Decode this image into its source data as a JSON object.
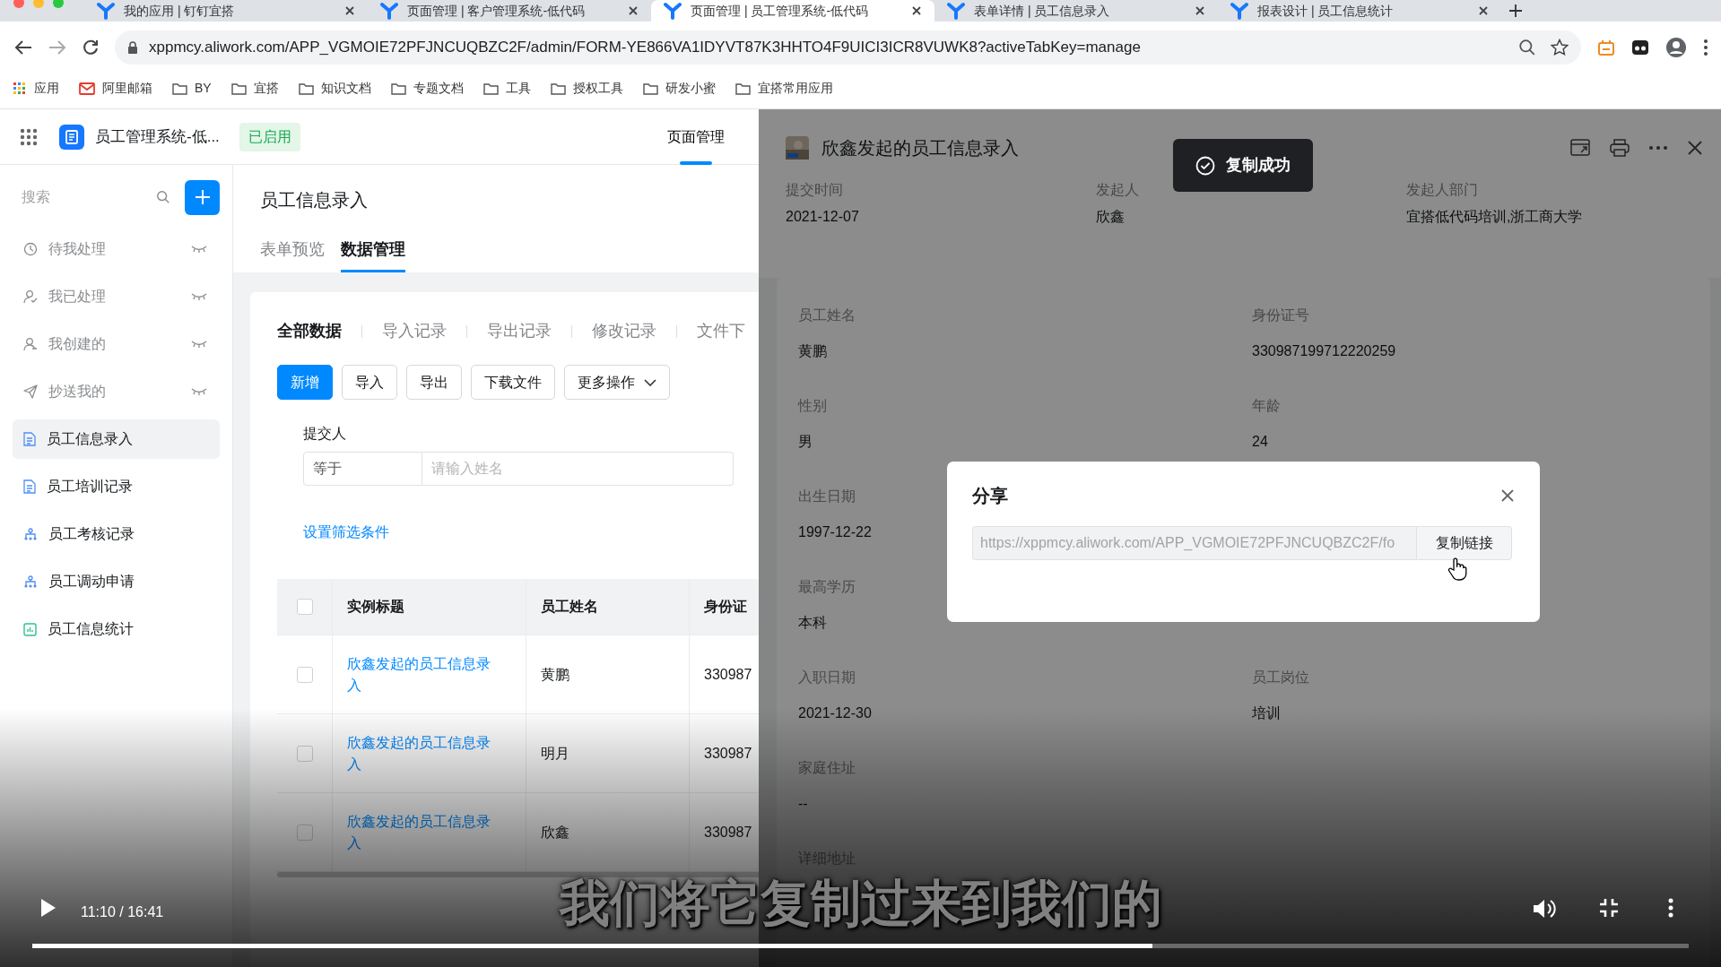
{
  "browser": {
    "tabs": [
      {
        "title": "我的应用 | 钉钉宜搭",
        "selected": false
      },
      {
        "title": "页面管理 | 客户管理系统-低代码",
        "selected": false
      },
      {
        "title": "页面管理 | 员工管理系统-低代码",
        "selected": true
      },
      {
        "title": "表单详情 | 员工信息录入",
        "selected": false
      },
      {
        "title": "报表设计 | 员工信息统计",
        "selected": false
      }
    ],
    "url": "xppmcy.aliwork.com/APP_VGMOIE72PFJNCUQBZC2F/admin/FORM-YE866VA1IDYVT87K3HHTO4F9UICI3ICR8VUWK8?activeTabKey=manage",
    "bookmarks": [
      {
        "label": "应用",
        "kind": "apps"
      },
      {
        "label": "阿里邮箱",
        "kind": "mail"
      },
      {
        "label": "BY",
        "kind": "folder"
      },
      {
        "label": "宜搭",
        "kind": "folder"
      },
      {
        "label": "知识文档",
        "kind": "folder"
      },
      {
        "label": "专题文档",
        "kind": "folder"
      },
      {
        "label": "工具",
        "kind": "folder"
      },
      {
        "label": "授权工具",
        "kind": "folder"
      },
      {
        "label": "研发小蜜",
        "kind": "folder"
      },
      {
        "label": "宜搭常用应用",
        "kind": "folder"
      }
    ]
  },
  "app": {
    "name": "员工管理系统-低...",
    "status": "已启用",
    "nav": [
      {
        "label": "页面管理",
        "selected": true
      }
    ]
  },
  "sidebar": {
    "search_placeholder": "搜索",
    "items": [
      {
        "label": "待我处理",
        "kind": "pending",
        "selected": false
      },
      {
        "label": "我已处理",
        "kind": "done",
        "selected": false
      },
      {
        "label": "我创建的",
        "kind": "created",
        "selected": false
      },
      {
        "label": "抄送我的",
        "kind": "cc",
        "selected": false
      },
      {
        "label": "员工信息录入",
        "kind": "form",
        "selected": true
      },
      {
        "label": "员工培训记录",
        "kind": "form",
        "selected": false
      },
      {
        "label": "员工考核记录",
        "kind": "flow",
        "selected": false
      },
      {
        "label": "员工调动申请",
        "kind": "flow",
        "selected": false
      },
      {
        "label": "员工信息统计",
        "kind": "report",
        "selected": false
      }
    ]
  },
  "page": {
    "title": "员工信息录入",
    "tabs": [
      {
        "label": "表单预览",
        "selected": false
      },
      {
        "label": "数据管理",
        "selected": true
      }
    ],
    "subtabs": [
      {
        "label": "全部数据",
        "selected": true
      },
      {
        "label": "导入记录",
        "selected": false
      },
      {
        "label": "导出记录",
        "selected": false
      },
      {
        "label": "修改记录",
        "selected": false
      },
      {
        "label": "文件下",
        "selected": false
      }
    ],
    "buttons": [
      {
        "label": "新增",
        "kind": "primary"
      },
      {
        "label": "导入",
        "kind": "default"
      },
      {
        "label": "导出",
        "kind": "default"
      },
      {
        "label": "下载文件",
        "kind": "default"
      },
      {
        "label": "更多操作",
        "kind": "dropdown"
      }
    ],
    "filter": {
      "label": "提交人",
      "operator": "等于",
      "placeholder": "请输入姓名",
      "link": "设置筛选条件"
    },
    "table": {
      "all_checked": false,
      "columns": [
        "实例标题",
        "员工姓名",
        "身份证"
      ],
      "rows": [
        {
          "checked": false,
          "cells": [
            "欣鑫发起的员工信息录入",
            "黄鹏",
            "330987"
          ]
        },
        {
          "checked": false,
          "cells": [
            "欣鑫发起的员工信息录入",
            "明月",
            "330987"
          ]
        },
        {
          "checked": false,
          "cells": [
            "欣鑫发起的员工信息录入",
            "欣鑫",
            "330987"
          ]
        }
      ]
    }
  },
  "drawer": {
    "title": "欣鑫发起的员工信息录入",
    "meta": [
      {
        "label": "提交时间",
        "value": "2021-12-07"
      },
      {
        "label": "发起人",
        "value": "欣鑫"
      },
      {
        "label": "发起人部门",
        "value": "宜搭低代码培训,浙工商大学"
      }
    ],
    "rows": [
      [
        {
          "label": "员工姓名",
          "value": "黄鹏"
        },
        {
          "label": "身份证号",
          "value": "330987199712220259"
        }
      ],
      [
        {
          "label": "性别",
          "value": "男"
        },
        {
          "label": "年龄",
          "value": "24"
        }
      ],
      [
        {
          "label": "出生日期",
          "value": "1997-12-22"
        }
      ],
      [
        {
          "label": "最高学历",
          "value": "本科"
        }
      ],
      [
        {
          "label": "入职日期",
          "value": "2021-12-30"
        },
        {
          "label": "员工岗位",
          "value": "培训"
        }
      ],
      [
        {
          "label": "家庭住址",
          "value": "--"
        }
      ],
      [
        {
          "label": "详细地址"
        }
      ]
    ]
  },
  "toast": {
    "text": "复制成功"
  },
  "share": {
    "title": "分享",
    "link": "https://xppmcy.aliwork.com/APP_VGMOIE72PFJNCUQBZC2F/fo",
    "button": "复制链接"
  },
  "video": {
    "playing": false,
    "time": "11:10 / 16:41",
    "subtitle": "我们将它复制过来到我们的",
    "level": 0.676
  }
}
